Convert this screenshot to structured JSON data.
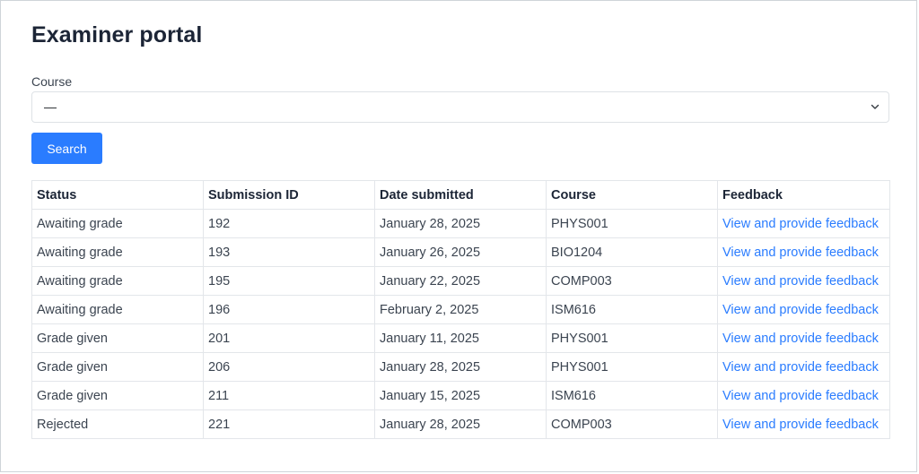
{
  "page": {
    "title": "Examiner portal"
  },
  "filter": {
    "label": "Course",
    "selected": "—",
    "search_label": "Search"
  },
  "table": {
    "headers": [
      "Status",
      "Submission ID",
      "Date submitted",
      "Course",
      "Feedback"
    ],
    "rows": [
      {
        "status": "Awaiting grade",
        "id": "192",
        "date": "January 28, 2025",
        "course": "PHYS001",
        "feedback": "View and provide feedback"
      },
      {
        "status": "Awaiting grade",
        "id": "193",
        "date": "January 26, 2025",
        "course": "BIO1204",
        "feedback": "View and provide feedback"
      },
      {
        "status": "Awaiting grade",
        "id": "195",
        "date": "January 22, 2025",
        "course": "COMP003",
        "feedback": "View and provide feedback"
      },
      {
        "status": "Awaiting grade",
        "id": "196",
        "date": "February 2, 2025",
        "course": "ISM616",
        "feedback": "View and provide feedback"
      },
      {
        "status": "Grade given",
        "id": "201",
        "date": "January 11, 2025",
        "course": "PHYS001",
        "feedback": "View and provide feedback"
      },
      {
        "status": "Grade given",
        "id": "206",
        "date": "January 28, 2025",
        "course": "PHYS001",
        "feedback": "View and provide feedback"
      },
      {
        "status": "Grade given",
        "id": "211",
        "date": "January 15, 2025",
        "course": "ISM616",
        "feedback": "View and provide feedback"
      },
      {
        "status": "Rejected",
        "id": "221",
        "date": "January 28, 2025",
        "course": "COMP003",
        "feedback": "View and provide feedback"
      }
    ]
  },
  "colors": {
    "accent": "#2a7cff",
    "heading": "#1c2536",
    "border": "#e3e6ea"
  },
  "icons": {
    "select_caret": "chevron-down-icon"
  }
}
